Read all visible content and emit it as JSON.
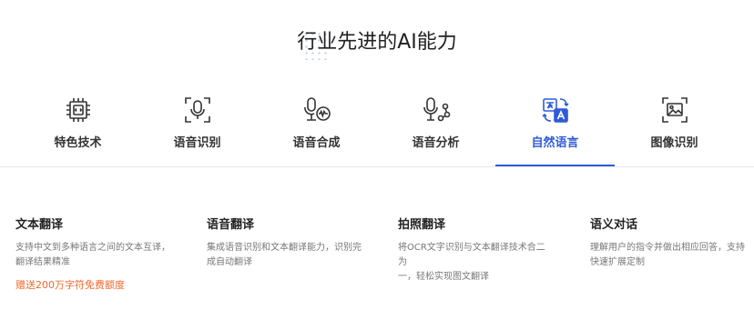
{
  "section_title": "行业先进的AI能力",
  "colors": {
    "accent": "#2f5bd8",
    "promo": "#f0682e",
    "icon_dark": "#333333"
  },
  "tabs": [
    {
      "label": "特色技术",
      "icon": "chip-icon",
      "active": false
    },
    {
      "label": "语音识别",
      "icon": "microphone-scan-icon",
      "active": false
    },
    {
      "label": "语音合成",
      "icon": "microphone-wave-icon",
      "active": false
    },
    {
      "label": "语音分析",
      "icon": "microphone-nodes-icon",
      "active": false
    },
    {
      "label": "自然语言",
      "icon": "translate-icon",
      "active": true
    },
    {
      "label": "图像识别",
      "icon": "image-scan-icon",
      "active": false
    }
  ],
  "features": [
    {
      "name": "文本翻译",
      "desc_line1": "支持中文到多种语言之间的文本互译，",
      "desc_line2": "翻译结果精准",
      "promo": "赠送200万字符免费额度"
    },
    {
      "name": "语音翻译",
      "desc_line1": "集成语音识别和文本翻译能力，识别完",
      "desc_line2": "成自动翻译"
    },
    {
      "name": "拍照翻译",
      "desc_line1": "将OCR文字识别与文本翻译技术合二为",
      "desc_line2": "一，轻松实现图文翻译"
    },
    {
      "name": "语义对话",
      "desc_line1": "理解用户的指令并做出相应回答，支持",
      "desc_line2": "快速扩展定制"
    }
  ]
}
